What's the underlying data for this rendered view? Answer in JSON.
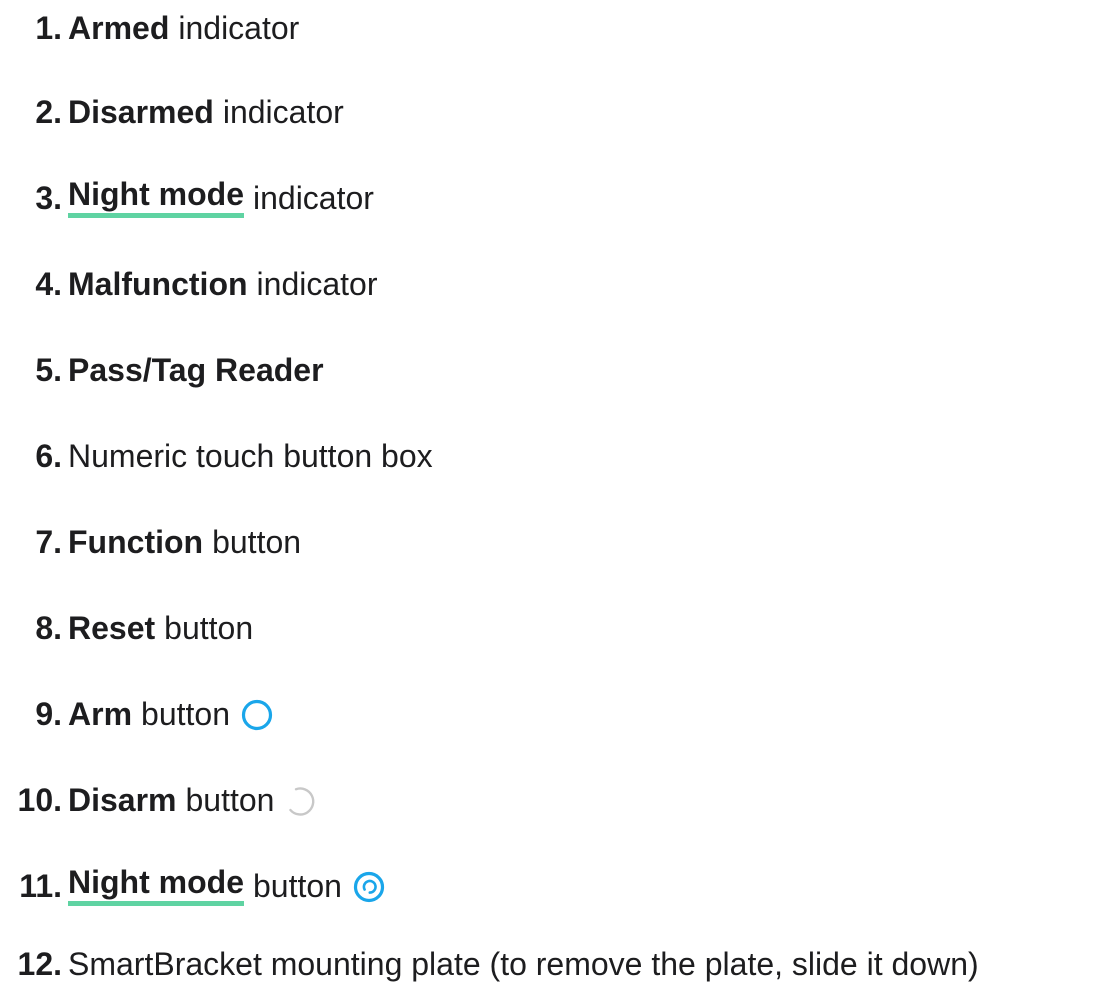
{
  "items": [
    {
      "num": "1.",
      "bold": "Armed",
      "rest": "indicator"
    },
    {
      "num": "2.",
      "bold": "Disarmed",
      "rest": "indicator"
    },
    {
      "num": "3.",
      "bold": "Night mode",
      "rest": "indicator"
    },
    {
      "num": "4.",
      "bold": "Malfunction",
      "rest": "indicator"
    },
    {
      "num": "5.",
      "bold": "Pass/Tag Reader",
      "rest": ""
    },
    {
      "num": "6.",
      "bold": "",
      "rest": "Numeric touch button box"
    },
    {
      "num": "7.",
      "bold": "Function",
      "rest": "button"
    },
    {
      "num": "8.",
      "bold": "Reset",
      "rest": "button"
    },
    {
      "num": "9.",
      "bold": "Arm",
      "rest": "button"
    },
    {
      "num": "10.",
      "bold": "Disarm",
      "rest": "button"
    },
    {
      "num": "11.",
      "bold": "Night mode",
      "rest": "button"
    },
    {
      "num": "12.",
      "bold": "",
      "rest": "SmartBracket mounting plate (to remove the plate, slide it down)"
    }
  ],
  "icons": {
    "arm": "arm-ring-icon",
    "disarm": "disarm-arc-icon",
    "night": "night-mode-icon"
  },
  "colors": {
    "text": "#1d1d1f",
    "link_underline": "#5fd3a2",
    "icon_blue": "#1aa6ea",
    "icon_gray": "#c8c8c8"
  }
}
